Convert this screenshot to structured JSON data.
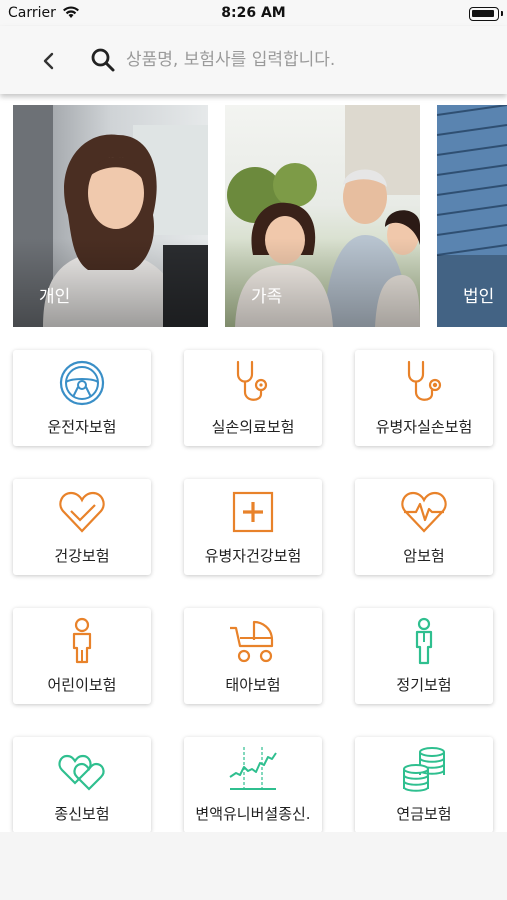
{
  "status_bar": {
    "carrier": "Carrier",
    "time": "8:26 AM"
  },
  "search": {
    "placeholder": "상품명, 보험사를 입력합니다."
  },
  "banners": [
    {
      "label": "개인"
    },
    {
      "label": "가족"
    },
    {
      "label": "법인"
    }
  ],
  "categories": [
    {
      "label": "운전자보험",
      "icon": "steering-wheel-icon",
      "color": "#3a8fc7"
    },
    {
      "label": "실손의료보험",
      "icon": "stethoscope-icon",
      "color": "#e8822a"
    },
    {
      "label": "유병자실손보험",
      "icon": "stethoscope-icon",
      "color": "#e8822a"
    },
    {
      "label": "건강보험",
      "icon": "heart-check-icon",
      "color": "#e8822a"
    },
    {
      "label": "유병자건강보험",
      "icon": "medical-plus-icon",
      "color": "#e8822a"
    },
    {
      "label": "암보험",
      "icon": "heart-pulse-icon",
      "color": "#e8822a"
    },
    {
      "label": "어린이보험",
      "icon": "child-icon",
      "color": "#e8822a"
    },
    {
      "label": "태아보험",
      "icon": "baby-stroller-icon",
      "color": "#e8822a"
    },
    {
      "label": "정기보험",
      "icon": "person-icon",
      "color": "#2fbf8f"
    },
    {
      "label": "종신보험",
      "icon": "two-hearts-icon",
      "color": "#2fbf8f"
    },
    {
      "label": "변액유니버셜종신.",
      "icon": "stock-chart-icon",
      "color": "#2fbf8f"
    },
    {
      "label": "연금보험",
      "icon": "coin-stack-icon",
      "color": "#2fbf8f"
    }
  ]
}
